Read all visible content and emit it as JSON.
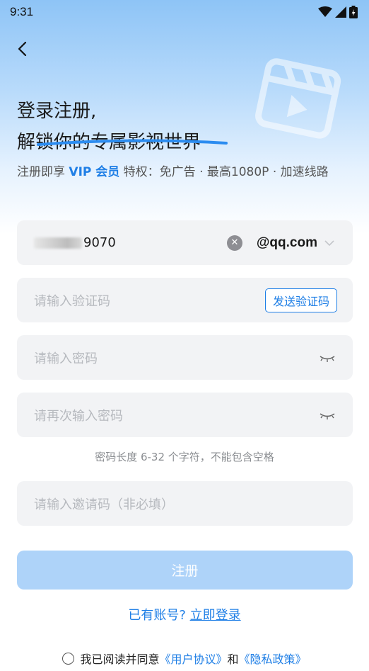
{
  "status_bar": {
    "time": "9:31"
  },
  "header": {
    "title_line1": "登录注册,",
    "title_line2": "解锁你的专属影视世界",
    "benefits_prefix": "注册即享 ",
    "benefits_vip": "VIP 会员",
    "benefits_suffix": " 特权：免广告 · 最高1080P · 加速线路"
  },
  "form": {
    "email_value": "9070",
    "email_domain": "@qq.com",
    "code_placeholder": "请输入验证码",
    "send_code_label": "发送验证码",
    "password_placeholder": "请输入密码",
    "confirm_password_placeholder": "请再次输入密码",
    "password_hint": "密码长度 6-32 个字符，不能包含空格",
    "invite_placeholder": "请输入邀请码（非必填）",
    "register_label": "注册"
  },
  "footer": {
    "have_account": "已有账号? ",
    "login_link": "立即登录",
    "agree_prefix": "我已阅读并同意",
    "user_agreement": "《用户协议》",
    "and": "和",
    "privacy_policy": "《隐私政策》"
  },
  "colors": {
    "accent": "#1f7fe6",
    "button_disabled": "#aed3f9",
    "field_bg": "#f2f3f5"
  }
}
